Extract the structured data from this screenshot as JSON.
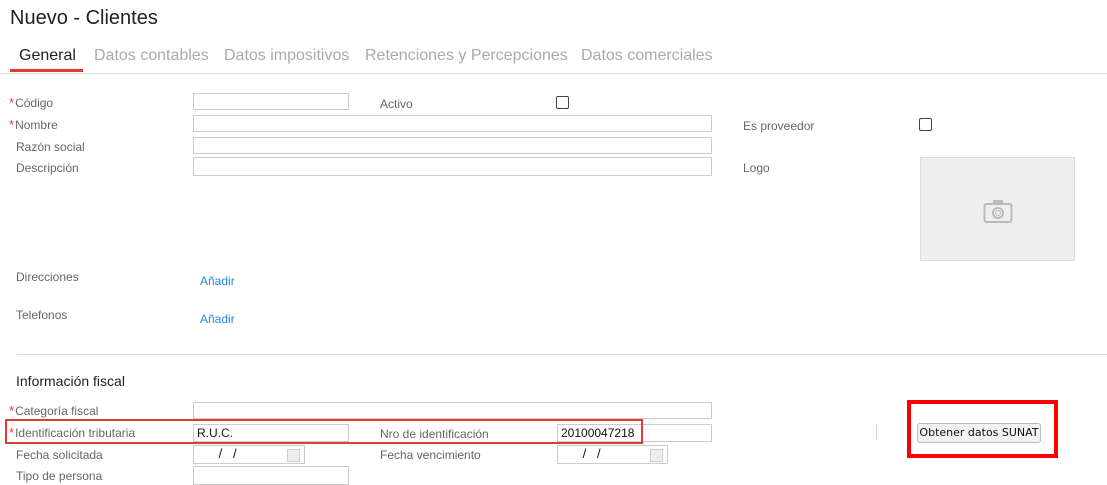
{
  "title": "Nuevo - Clientes",
  "tabs": [
    "General",
    "Datos contables",
    "Datos impositivos",
    "Retenciones y Percepciones",
    "Datos comerciales"
  ],
  "fields": {
    "codigo": "Código",
    "activo": "Activo",
    "nombre": "Nombre",
    "es_proveedor": "Es proveedor",
    "razon_social": "Razón social",
    "descripcion": "Descripción",
    "logo": "Logo",
    "direcciones": "Direcciones",
    "telefonos": "Telefonos",
    "add": "Añadir"
  },
  "fiscal": {
    "heading": "Información fiscal",
    "categoria": "Categoría fiscal",
    "identificacion": "Identificación tributaria",
    "identificacion_value": "R.U.C.",
    "nro": "Nro de identificación",
    "nro_value": "20100047218",
    "fecha_solicitada": "Fecha solicitada",
    "fecha_vencimiento": "Fecha vencimiento",
    "date_placeholder": " /   /",
    "tipo_persona": "Tipo de persona",
    "sunat_button": "Obtener datos SUNAT"
  },
  "required_mark": "*"
}
